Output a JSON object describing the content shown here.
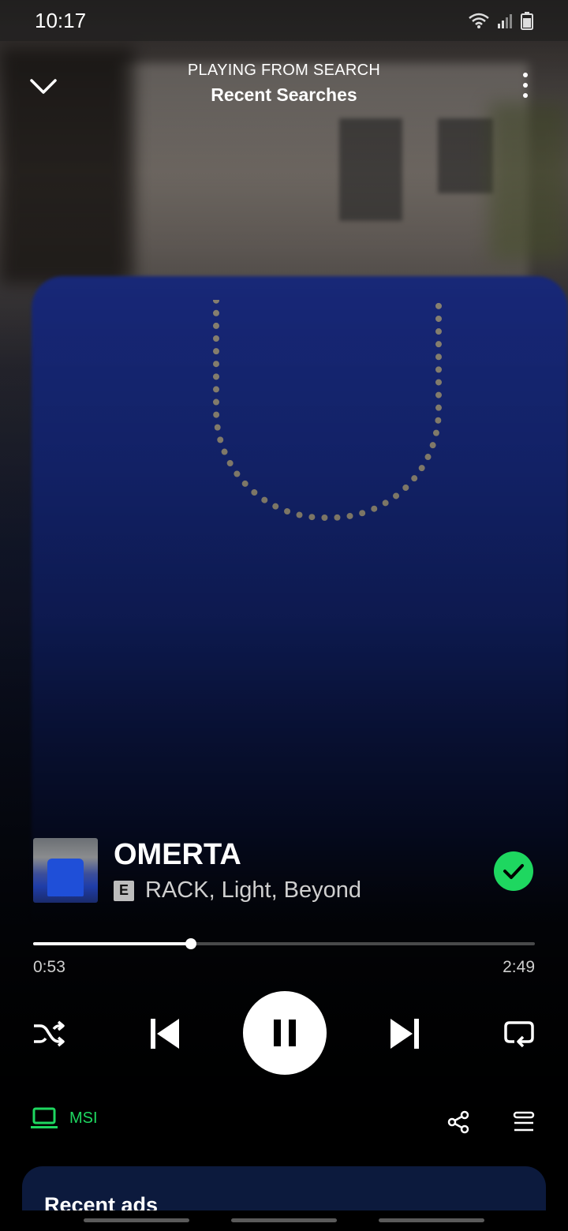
{
  "status_bar": {
    "time": "10:17",
    "icons": [
      "wifi-icon",
      "signal-icon",
      "battery-icon"
    ]
  },
  "header": {
    "context": "PLAYING FROM SEARCH",
    "title": "Recent Searches",
    "collapse_icon": "chevron-down-icon",
    "menu_icon": "more-vertical-icon"
  },
  "track": {
    "title": "OMERTA",
    "explicit_label": "E",
    "artists": "RACK, Light, Beyond",
    "liked": true
  },
  "progress": {
    "elapsed": "0:53",
    "total": "2:49",
    "fraction": 0.314
  },
  "controls": {
    "shuffle_icon": "shuffle-icon",
    "previous_icon": "skip-previous-icon",
    "play_state": "playing",
    "next_icon": "skip-next-icon",
    "repeat_icon": "repeat-icon"
  },
  "device": {
    "label": "MSI",
    "icon": "laptop-icon"
  },
  "actions": {
    "share_icon": "share-icon",
    "queue_icon": "queue-icon"
  },
  "card": {
    "title": "Recent ads"
  },
  "colors": {
    "accent": "#1ed760",
    "card_bg": "#0c1a3d"
  }
}
